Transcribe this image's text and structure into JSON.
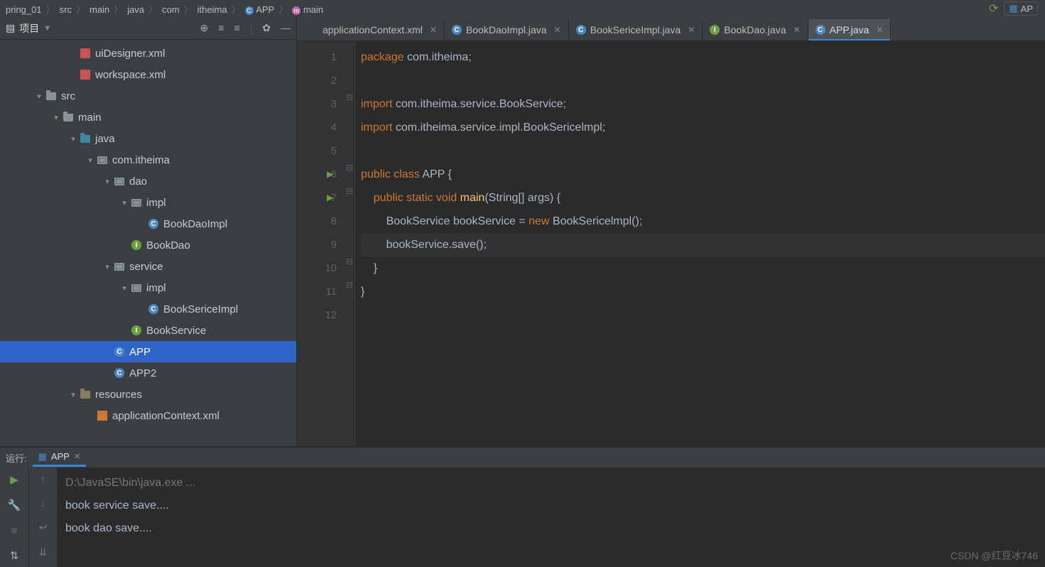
{
  "breadcrumb": {
    "parts": [
      "pring_01",
      "src",
      "main",
      "java",
      "com",
      "itheima",
      "APP",
      "main"
    ]
  },
  "project": {
    "title": "项目",
    "tree": [
      {
        "d": 4,
        "t": "xml",
        "arr": "",
        "lbl": "uiDesigner.xml"
      },
      {
        "d": 4,
        "t": "xml",
        "arr": "",
        "lbl": "workspace.xml"
      },
      {
        "d": 2,
        "t": "folder",
        "arr": "▾",
        "lbl": "src"
      },
      {
        "d": 3,
        "t": "folder",
        "arr": "▾",
        "lbl": "main"
      },
      {
        "d": 4,
        "t": "folder-blue",
        "arr": "▾",
        "lbl": "java"
      },
      {
        "d": 5,
        "t": "pkg",
        "arr": "▾",
        "lbl": "com.itheima"
      },
      {
        "d": 6,
        "t": "pkg",
        "arr": "▾",
        "lbl": "dao"
      },
      {
        "d": 7,
        "t": "pkg",
        "arr": "▾",
        "lbl": "impl"
      },
      {
        "d": 8,
        "t": "class",
        "arr": "",
        "lbl": "BookDaoImpl"
      },
      {
        "d": 7,
        "t": "iface",
        "arr": "",
        "lbl": "BookDao"
      },
      {
        "d": 6,
        "t": "pkg",
        "arr": "▾",
        "lbl": "service"
      },
      {
        "d": 7,
        "t": "pkg",
        "arr": "▾",
        "lbl": "impl"
      },
      {
        "d": 8,
        "t": "class",
        "arr": "",
        "lbl": "BookSericeImpl"
      },
      {
        "d": 7,
        "t": "iface",
        "arr": "",
        "lbl": "BookService"
      },
      {
        "d": 6,
        "t": "class-run",
        "arr": "",
        "lbl": "APP",
        "sel": true
      },
      {
        "d": 6,
        "t": "class-run",
        "arr": "",
        "lbl": "APP2"
      },
      {
        "d": 4,
        "t": "folder-res",
        "arr": "▾",
        "lbl": "resources"
      },
      {
        "d": 5,
        "t": "xml2",
        "arr": "",
        "lbl": "applicationContext.xml"
      }
    ]
  },
  "tabs": [
    {
      "icon": "xml2",
      "label": "applicationContext.xml"
    },
    {
      "icon": "class",
      "label": "BookDaoImpl.java"
    },
    {
      "icon": "class",
      "label": "BookSericeImpl.java"
    },
    {
      "icon": "iface",
      "label": "BookDao.java"
    },
    {
      "icon": "class-run",
      "label": "APP.java",
      "active": true
    }
  ],
  "code": {
    "lines": [
      {
        "n": 1,
        "html": "<span class='kw'>package</span> com.itheima;"
      },
      {
        "n": 2,
        "html": ""
      },
      {
        "n": 3,
        "html": "<span class='kw'>import</span> com.itheima.service.BookService;",
        "fold": "⊟"
      },
      {
        "n": 4,
        "html": "<span class='kw'>import</span> com.itheima.service.impl.BookSericelmpl;"
      },
      {
        "n": 5,
        "html": ""
      },
      {
        "n": 6,
        "html": "<span class='kw'>public class</span> <span class='pl'>APP</span> {",
        "run": true,
        "fold": "⊟"
      },
      {
        "n": 7,
        "html": "    <span class='kw'>public static void</span> <span class='fn'>main</span>(String[] args) {",
        "run": true,
        "fold": "⊟"
      },
      {
        "n": 8,
        "html": "        BookService bookService = <span class='kw'>new</span> BookSericelmpl();"
      },
      {
        "n": 9,
        "html": "        bookService.save();",
        "cur": true
      },
      {
        "n": 10,
        "html": "    }",
        "fold": "⊟"
      },
      {
        "n": 11,
        "html": "}",
        "fold": "⊟"
      },
      {
        "n": 12,
        "html": ""
      }
    ]
  },
  "run": {
    "label": "运行:",
    "tab": "APP",
    "output": [
      {
        "cls": "path",
        "text": "D:\\JavaSE\\bin\\java.exe ..."
      },
      {
        "cls": "",
        "text": "book service save...."
      },
      {
        "cls": "",
        "text": "book dao save...."
      }
    ]
  },
  "toolbar_right": {
    "button": "AP"
  },
  "watermark": "CSDN @红豆冰746"
}
